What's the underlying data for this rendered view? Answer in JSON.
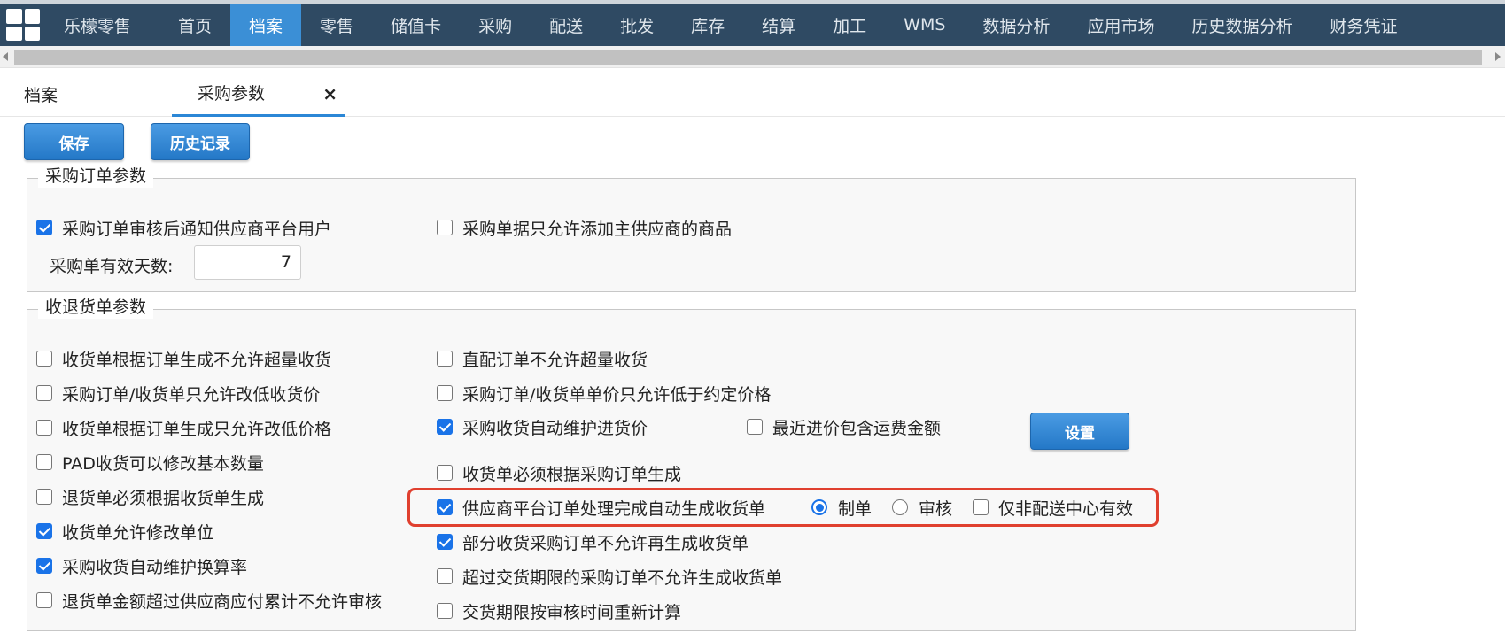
{
  "nav": {
    "brand": "乐檬零售",
    "items": [
      "首页",
      "档案",
      "零售",
      "储值卡",
      "采购",
      "配送",
      "批发",
      "库存",
      "结算",
      "加工",
      "WMS",
      "数据分析",
      "应用市场",
      "历史数据分析",
      "财务凭证"
    ],
    "active_index": 1
  },
  "tabs": {
    "first": "档案",
    "active": "采购参数",
    "close_glyph": "×"
  },
  "toolbar": {
    "save": "保存",
    "history": "历史记录"
  },
  "purchase_order": {
    "legend": "采购订单参数",
    "notify_supplier": {
      "label": "采购订单审核后通知供应商平台用户",
      "checked": true
    },
    "main_supplier_only": {
      "label": "采购单据只允许添加主供应商的商品",
      "checked": false
    },
    "valid_days_label": "采购单有效天数:",
    "valid_days_value": "7"
  },
  "receipt": {
    "legend": "收退货单参数",
    "left_col": [
      {
        "label": "收货单根据订单生成不允许超量收货",
        "checked": false
      },
      {
        "label": "采购订单/收货单只允许改低收货价",
        "checked": false
      },
      {
        "label": "收货单根据订单生成只允许改低价格",
        "checked": false
      },
      {
        "label": "PAD收货可以修改基本数量",
        "checked": false
      },
      {
        "label": "退货单必须根据收货单生成",
        "checked": false
      },
      {
        "label": "收货单允许修改单位",
        "checked": true
      },
      {
        "label": "采购收货自动维护换算率",
        "checked": true
      },
      {
        "label": "退货单金额超过供应商应付累计不允许审核",
        "checked": false
      }
    ],
    "right_col": [
      {
        "label": "直配订单不允许超量收货",
        "checked": false
      },
      {
        "label": "采购订单/收货单单价只允许低于约定价格",
        "checked": false
      },
      {
        "label": "采购收货自动维护进货价",
        "checked": true
      },
      {
        "label": "收货单必须根据采购订单生成",
        "checked": false
      },
      {
        "label": "供应商平台订单处理完成自动生成收货单",
        "checked": true
      },
      {
        "label": "部分收货采购订单不允许再生成收货单",
        "checked": true
      },
      {
        "label": "超过交货期限的采购订单不允许生成收货单",
        "checked": false
      },
      {
        "label": "交货期限按审核时间重新计算",
        "checked": false
      }
    ],
    "freight_include": {
      "label": "最近进价包含运费金额",
      "checked": false
    },
    "setting_button": "设置",
    "radio_draft": {
      "label": "制单",
      "checked": true
    },
    "radio_audit": {
      "label": "审核",
      "checked": false
    },
    "non_dc_only": {
      "label": "仅非配送中心有效",
      "checked": false
    }
  },
  "colors": {
    "nav_bg": "#2f4a63",
    "nav_active": "#3b8fd6",
    "button_blue": "#2b87d6",
    "check_blue": "#1a73e8",
    "highlight_red": "#e0402f"
  }
}
